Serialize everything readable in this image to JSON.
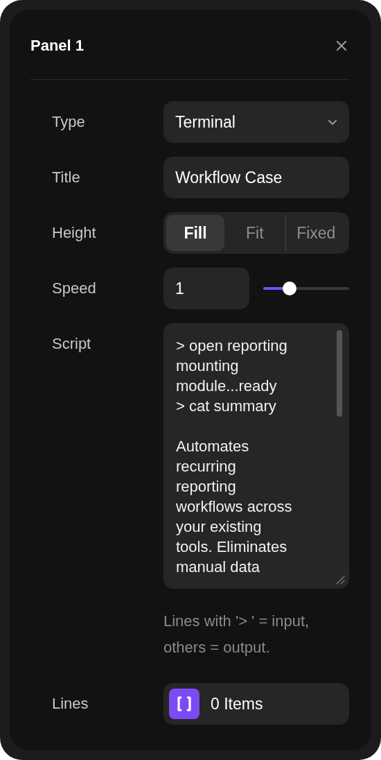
{
  "panel": {
    "title": "Panel 1"
  },
  "fields": [
    {
      "kind": "select",
      "label": "Type",
      "value": "Terminal"
    },
    {
      "kind": "text",
      "label": "Title",
      "value": "Workflow Case"
    },
    {
      "kind": "segmented",
      "label": "Height",
      "options": [
        {
          "label": "Fill",
          "selected": true
        },
        {
          "label": "Fit",
          "selected": false
        },
        {
          "label": "Fixed",
          "selected": false
        }
      ]
    },
    {
      "kind": "slider",
      "label": "Speed",
      "value": "1",
      "level": 0.31
    },
    {
      "kind": "script",
      "label": "Script",
      "paragraphs": [
        [
          "> open reporting",
          "mounting",
          "module...ready",
          "> cat summary"
        ],
        [
          "Automates",
          "recurring",
          "reporting",
          "workflows across",
          "your existing",
          "tools. Eliminates",
          "manual data"
        ]
      ],
      "hint": "Lines with '> ' = input, others = output."
    },
    {
      "kind": "list",
      "label": "Lines",
      "value": "0 Items"
    }
  ]
}
